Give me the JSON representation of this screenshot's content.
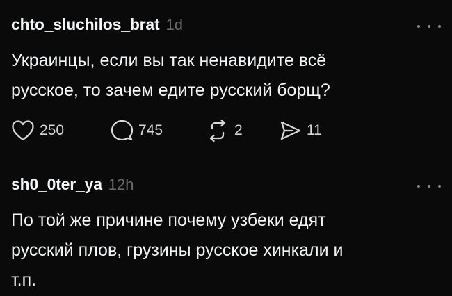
{
  "posts": [
    {
      "username": "chto_sluchilos_brat",
      "time": "1d",
      "text": "Украинцы, если вы так ненавидите всё\nрусское, то зачем едите русский борщ?",
      "likes": "250",
      "comments": "745",
      "reposts": "2",
      "shares": "11"
    },
    {
      "username": "sh0_0ter_ya",
      "time": "12h",
      "text": "По той же причине почему узбеки едят\nрусский плов, грузины русское хинкали и\nт.п."
    }
  ],
  "icons": {
    "like": "heart-icon",
    "comment": "speech-bubble-icon",
    "repost": "repost-icon",
    "share": "send-icon",
    "more": "more-horizontal-icon"
  },
  "colors": {
    "background": "#0a0a0a",
    "text": "#f3f5f7",
    "muted": "#6b6b6b"
  }
}
